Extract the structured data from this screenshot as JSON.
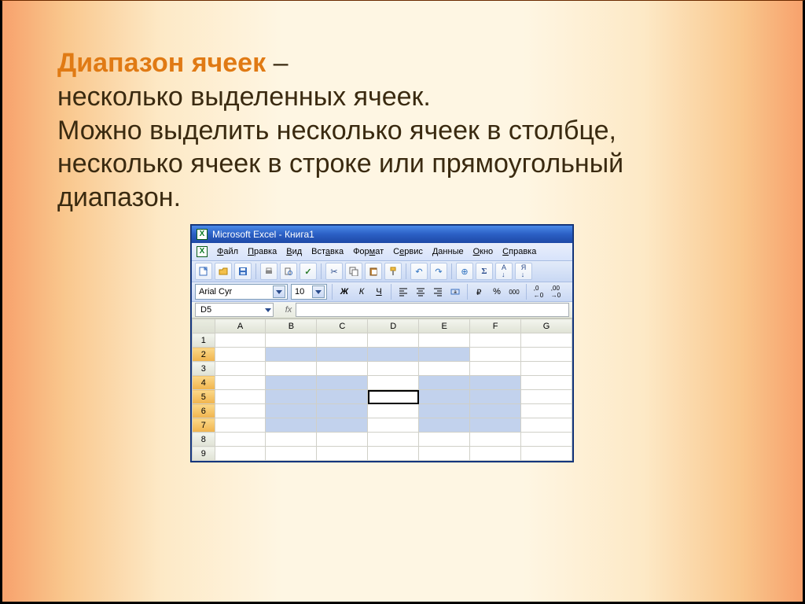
{
  "slide": {
    "title": "Диапазон ячеек",
    "dash": " –",
    "body_line1": "несколько выделенных ячеек.",
    "body_line2": "Можно выделить несколько ячеек в столбце, несколько ячеек в строке или прямоугольный диапазон."
  },
  "excel": {
    "title": "Microsoft Excel - Книга1",
    "menu": {
      "file": "Файл",
      "edit": "Правка",
      "view": "Вид",
      "insert": "Вставка",
      "format": "Формат",
      "tools": "Сервис",
      "data": "Данные",
      "window": "Окно",
      "help": "Справка"
    },
    "toolbar_icons": {
      "new": "new-doc-icon",
      "open": "open-icon",
      "save": "save-icon",
      "print": "print-icon",
      "preview": "print-preview-icon",
      "spell": "spellcheck-icon",
      "cut": "cut-icon",
      "copy": "copy-icon",
      "paste": "paste-icon",
      "format_painter": "format-painter-icon",
      "undo": "undo-icon",
      "redo": "redo-icon",
      "link": "hyperlink-icon",
      "sum": "autosum-icon",
      "sort_asc": "sort-asc-icon",
      "sort_desc": "sort-desc-icon"
    },
    "format": {
      "font": "Arial Cyr",
      "size": "10",
      "bold": "Ж",
      "italic": "К",
      "underline": "Ч",
      "currency": "₽",
      "percent": "%",
      "comma": "000",
      "inc_dec": "←,0",
      "dec_dec": ",00→"
    },
    "namebox": "D5",
    "fx": "fx",
    "columns": [
      "A",
      "B",
      "C",
      "D",
      "E",
      "F",
      "G"
    ],
    "rows": [
      "1",
      "2",
      "3",
      "4",
      "5",
      "6",
      "7",
      "8",
      "9"
    ],
    "selected_rows": [
      2,
      4,
      5,
      6,
      7
    ],
    "active_cell": "D5",
    "selection_map": {
      "2": [
        "B",
        "C",
        "D",
        "E"
      ],
      "4": [
        "B",
        "C",
        "E",
        "F"
      ],
      "5": [
        "B",
        "C",
        "E",
        "F"
      ],
      "6": [
        "B",
        "C",
        "E",
        "F"
      ],
      "7": [
        "B",
        "C",
        "E",
        "F"
      ]
    }
  }
}
